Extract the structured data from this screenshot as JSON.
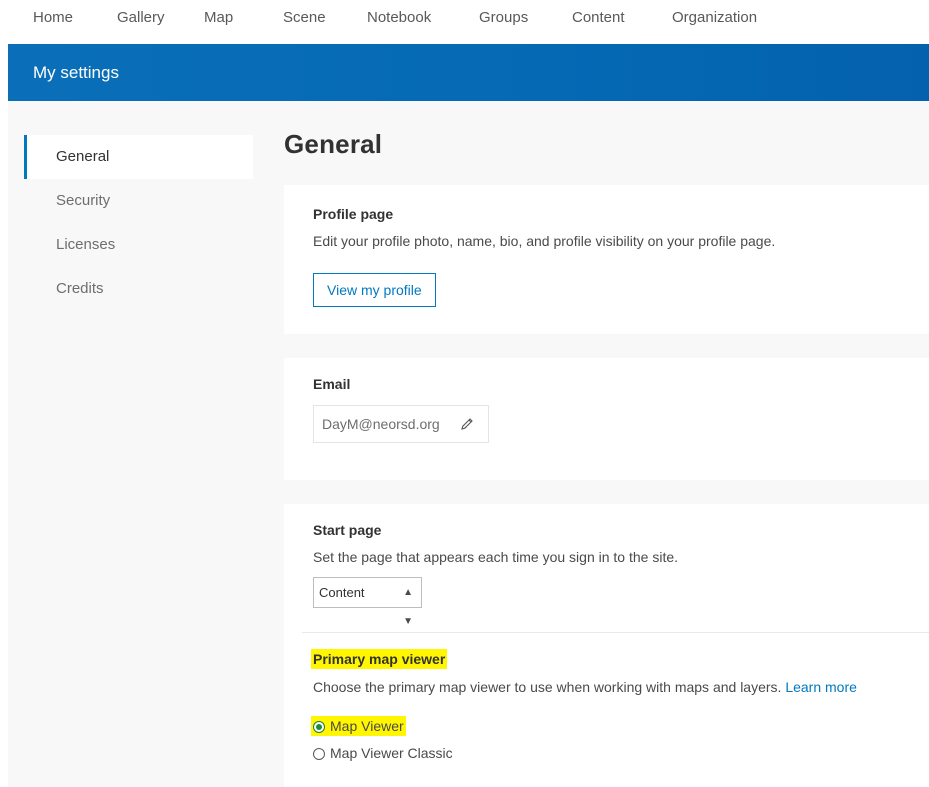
{
  "nav": {
    "items": [
      "Home",
      "Gallery",
      "Map",
      "Scene",
      "Notebook",
      "Groups",
      "Content",
      "Organization"
    ]
  },
  "header": {
    "title": "My settings"
  },
  "sidebar": {
    "items": [
      {
        "label": "General",
        "active": true
      },
      {
        "label": "Security",
        "active": false
      },
      {
        "label": "Licenses",
        "active": false
      },
      {
        "label": "Credits",
        "active": false
      }
    ]
  },
  "page": {
    "title": "General"
  },
  "profile": {
    "title": "Profile page",
    "description": "Edit your profile photo, name, bio, and profile visibility on your profile page.",
    "button_label": "View my profile"
  },
  "email": {
    "title": "Email",
    "value": "DayM@neorsd.org",
    "edit_icon": "pencil-icon"
  },
  "start_page": {
    "title": "Start page",
    "description": "Set the page that appears each time you sign in to the site.",
    "selected": "Content"
  },
  "map_viewer": {
    "title": "Primary map viewer",
    "description": "Choose the primary map viewer to use when working with maps and layers.",
    "learn_more": "Learn more",
    "options": [
      {
        "label": "Map Viewer",
        "checked": true
      },
      {
        "label": "Map Viewer Classic",
        "checked": false
      }
    ],
    "highlight_color": "#fff600"
  },
  "colors": {
    "accent": "#0079c1",
    "header": "#0569b4"
  }
}
